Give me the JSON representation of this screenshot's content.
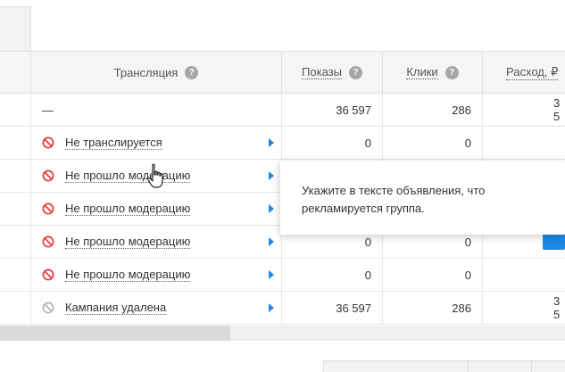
{
  "header": {
    "columns": [
      {
        "label": "",
        "help": false
      },
      {
        "label": "Трансляция",
        "help": true
      },
      {
        "label": "Показы",
        "help": true
      },
      {
        "label": "Клики",
        "help": true
      },
      {
        "label": "Расход, ₽",
        "help": false
      }
    ],
    "help_glyph": "?"
  },
  "rows": [
    {
      "status_icon": "none",
      "status": "—",
      "impressions": "36 597",
      "clicks": "286",
      "spend": "3 5",
      "has_arrow": false
    },
    {
      "status_icon": "blocked-icon",
      "status": "Не транслируется",
      "impressions": "0",
      "clicks": "0",
      "spend": "",
      "has_arrow": true
    },
    {
      "status_icon": "blocked-icon",
      "status": "Не прошло модерацию",
      "impressions": "",
      "clicks": "",
      "spend": "",
      "has_arrow": true
    },
    {
      "status_icon": "blocked-icon",
      "status": "Не прошло модерацию",
      "impressions": "",
      "clicks": "",
      "spend": "",
      "has_arrow": true
    },
    {
      "status_icon": "blocked-icon",
      "status": "Не прошло модерацию",
      "impressions": "0",
      "clicks": "0",
      "spend": "",
      "has_arrow": true
    },
    {
      "status_icon": "blocked-icon",
      "status": "Не прошло модерацию",
      "impressions": "0",
      "clicks": "0",
      "spend": "",
      "has_arrow": true
    },
    {
      "status_icon": "deleted-icon",
      "status": "Кампания удалена",
      "impressions": "36 597",
      "clicks": "286",
      "spend": "3 5",
      "has_arrow": true
    }
  ],
  "tooltip": {
    "text": "Укажите в тексте объявления, что рекламируется группа."
  },
  "colors": {
    "accent": "#1e88e5",
    "blocked": "#e53935",
    "deleted": "#b5b5b5",
    "header_bg": "#f5f5f5"
  }
}
